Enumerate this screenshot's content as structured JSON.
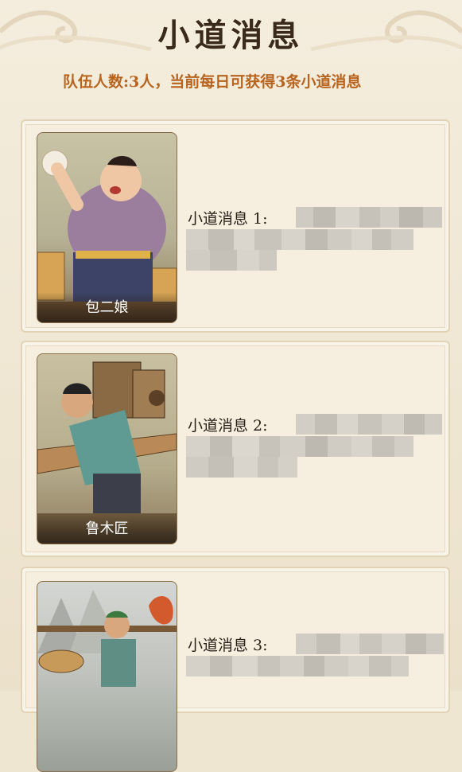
{
  "header": {
    "title": "小道消息",
    "subtitle": "队伍人数:3人，当前每日可获得3条小道消息"
  },
  "messages": [
    {
      "label": "小道消息 1:",
      "npc_name": "包二娘"
    },
    {
      "label": "小道消息 2:",
      "npc_name": "鲁木匠"
    },
    {
      "label": "小道消息 3:",
      "npc_name": ""
    }
  ],
  "colors": {
    "accent": "#b8641f",
    "title": "#3a2a1c",
    "background": "#efe6d2"
  }
}
